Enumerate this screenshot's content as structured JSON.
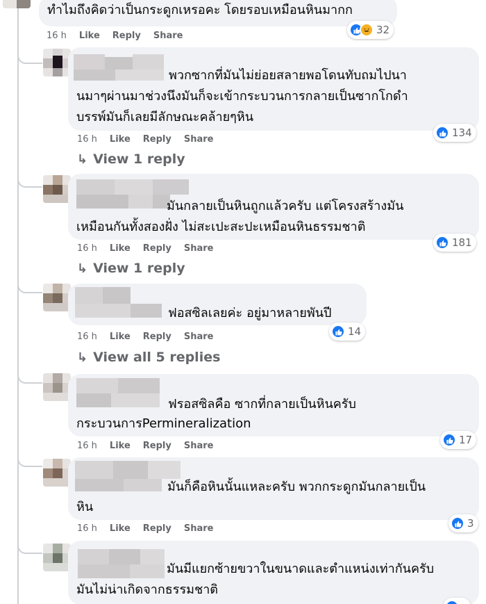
{
  "top_comment": {
    "text": "ทำไมถึงคิดว่าเป็นกระดูกเหรอคะ โดยรอบเหมือนหินมากก",
    "time": "16 h",
    "like_label": "Like",
    "reply_label": "Share",
    "share_label": "Share",
    "reaction_count": "32",
    "reactions": [
      "like",
      "haha"
    ]
  },
  "actions": {
    "like": "Like",
    "reply": "Reply",
    "share": "Share"
  },
  "replies": [
    {
      "lines": [
        "พวกซากที่มันไม่ย่อยสลายพอโดนทับถมไปนา",
        "นมาๆผ่านมาช่วงนึงมันก็จะเข้ากระบวนการกลายเป็นซากโกดำ",
        "บรรพ์มันก็เลยมีลักษณะคล้ายๆหิน"
      ],
      "time": "16 h",
      "reaction_count": "134",
      "view_replies": "View 1 reply"
    },
    {
      "lines": [
        "มันกลายเป็นหินถูกแล้วครับ แต่โครงสร้างมัน",
        "เหมือนกันทั้งสองฝั่ง ไม่สะเปะสะปะเหมือนหินธรรมชาติ"
      ],
      "time": "16 h",
      "reaction_count": "181",
      "view_replies": "View 1 reply"
    },
    {
      "lines": [
        "ฟอสซิลเลยค่ะ อยู่มาหลายพันปี"
      ],
      "time": "16 h",
      "reaction_count": "14",
      "view_replies": "View all 5 replies"
    },
    {
      "lines": [
        "ฟรอสซิลคือ ซากที่กลายเป็นหินครับ",
        "กระบวนการPermineralization"
      ],
      "time": "16 h",
      "reaction_count": "17"
    },
    {
      "lines": [
        "มันก็คือหินนั้นแหละครับ พวกกระดูกมันกลายเป็น",
        "หิน"
      ],
      "time": "16 h",
      "reaction_count": "3"
    },
    {
      "lines": [
        "มันมีแยกซ้ายขวาในขนาดและตำแหน่งเท่ากันครับ",
        "มันไม่น่าเกิดจากธรรมชาติ"
      ]
    }
  ],
  "colors": {
    "bubble": "#f0f2f5",
    "text": "#050505",
    "meta": "#65676b",
    "like_blue": "#1877f2",
    "thread_line": "#ced0d4"
  }
}
